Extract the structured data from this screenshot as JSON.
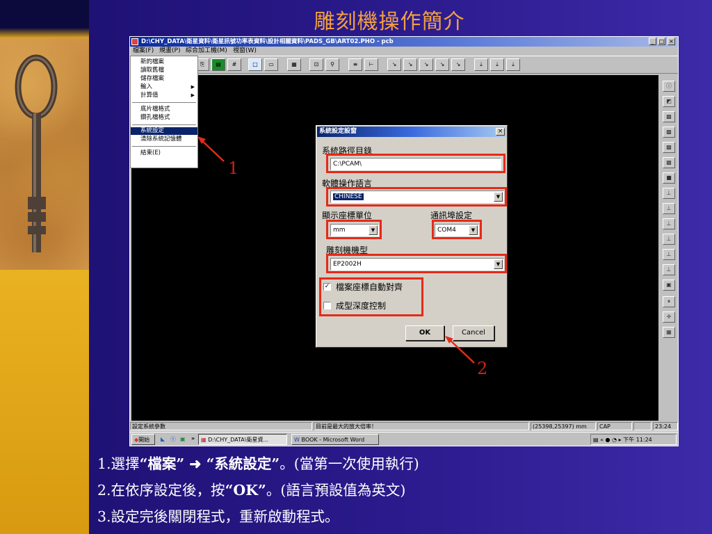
{
  "slide": {
    "title": "雕刻機操作簡介"
  },
  "window": {
    "title": "D:\\CHY_DATA\\衛星資料\\衛星訊號功率表資料\\設計相關資料\\PADS_GB\\ART02.PHO - pcb",
    "controls": [
      "_",
      "□",
      "×"
    ]
  },
  "menubar": [
    "檔案(F)",
    "規畫(P)",
    "綜合加工機(M)",
    "視窗(W)"
  ],
  "file_menu": {
    "items": [
      {
        "label": "新的檔案"
      },
      {
        "label": "讀取舊檔"
      },
      {
        "label": "儲存檔案"
      },
      {
        "label": "輸入",
        "submenu": "▶"
      },
      {
        "label": "計算值",
        "submenu": "▶"
      },
      {
        "label": "底片檔格式"
      },
      {
        "label": "鑽孔檔格式"
      },
      {
        "label": "系統設定",
        "selected": true
      },
      {
        "label": "清除系統記憶體"
      },
      {
        "label": "結束(E)"
      }
    ]
  },
  "dialog": {
    "title": "系統設定設窗",
    "close": "×",
    "path_label": "系統路徑目錄",
    "path_value": "C:\\PCAM\\",
    "language_label": "軟體操作語言",
    "language_value": "CHINESE",
    "units_label": "顯示座標單位",
    "units_value": "mm",
    "port_label": "通訊埠設定",
    "port_value": "COM4",
    "model_label": "雕刻機機型",
    "model_value": "EP2002H",
    "auto_align_label": "檔案座標自動對齊",
    "auto_align_checked": "✓",
    "depth_control_label": "成型深度控制",
    "depth_control_checked": "",
    "ok": "OK",
    "cancel": "Cancel",
    "dropdown_arrow": "▼"
  },
  "status_bar": {
    "left": "設定系統參數",
    "middle": "目前是最大的放大倍率！",
    "coords": "(25398,25397) mm",
    "caps": "CAP",
    "time": "23:24"
  },
  "taskbar": {
    "start": "開始",
    "task1": "D:\\CHY_DATA\\衛星資...",
    "task2": "BOOK - Microsoft Word",
    "clock": "下午 11:24",
    "chevron": "»"
  },
  "callouts": {
    "first": "1",
    "second": "2"
  },
  "instructions": {
    "line1": {
      "prefix": "1.選擇",
      "q1": "“",
      "w1": "檔案",
      "q2": "”",
      "arrow": " ➜ ",
      "q3": "“",
      "w2": "系統設定",
      "q4": "”",
      "suffix": "。(當第一次使用執行)"
    },
    "line2": {
      "prefix": "2.在依序設定後，按",
      "q1": "“",
      "w1": "OK",
      "q2": "”",
      "suffix": "。(語言預設值為英文)"
    },
    "line3": "3.設定完後關閉程式，重新啟動程式。"
  },
  "colors": {
    "title": "#f2a040",
    "highlight": "#e52a18",
    "callout": "#d02010",
    "background": "#2a1a8c"
  }
}
